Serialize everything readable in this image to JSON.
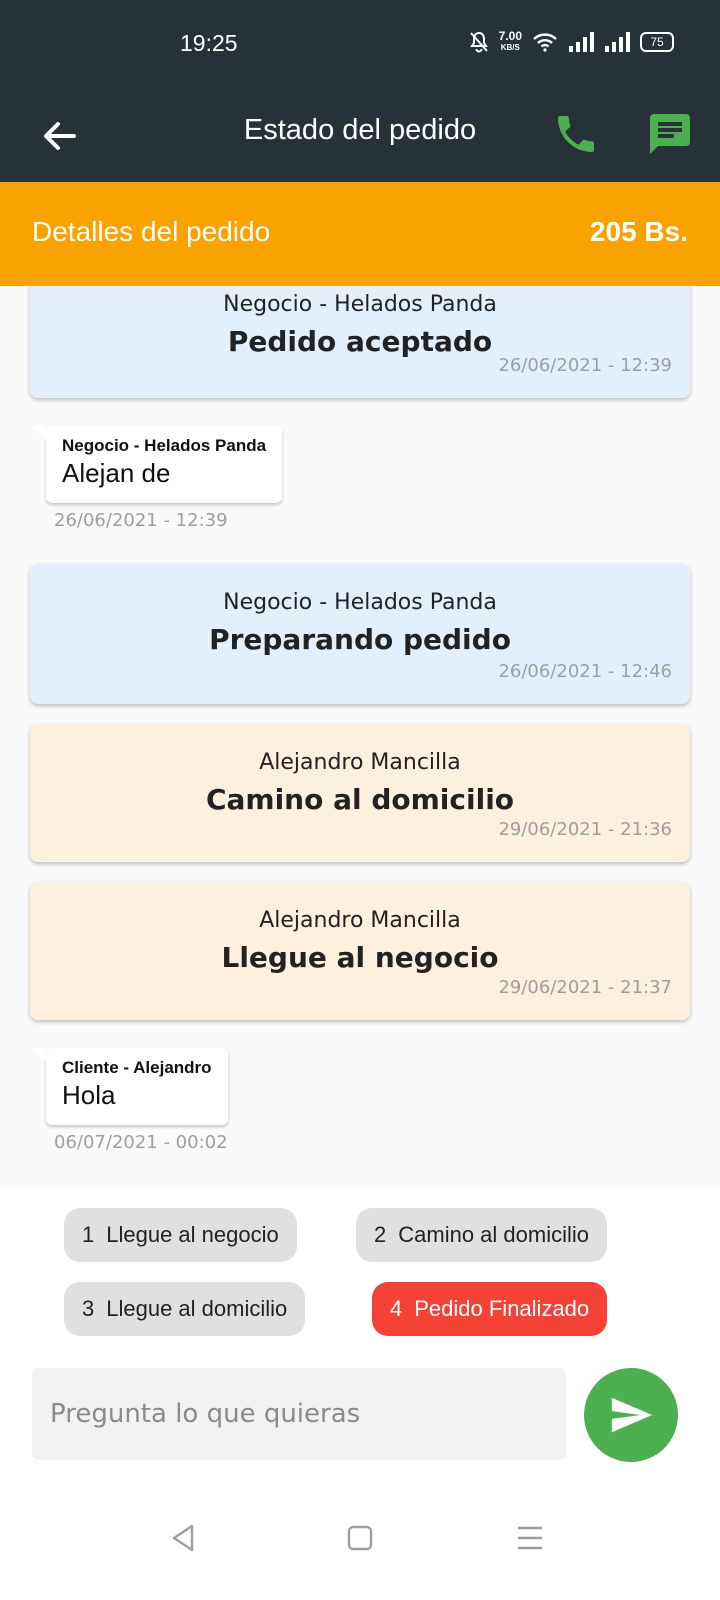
{
  "status_bar": {
    "time": "19:25",
    "net_speed": "7.00",
    "net_unit": "KB/S",
    "battery": "75",
    "icons": [
      "bell-muted-icon",
      "wifi-icon",
      "signal-icon",
      "signal-icon",
      "battery-icon"
    ]
  },
  "app_bar": {
    "title": "Estado del pedido",
    "icons": [
      "arrow-back-icon",
      "phone-icon",
      "message-icon"
    ],
    "accent_icon_color": "#4caf50",
    "background": "#263238"
  },
  "details": {
    "label": "Detalles del pedido",
    "total": "205 Bs.",
    "background": "#f9a200"
  },
  "feed": {
    "items": [
      {
        "kind": "status",
        "who": "Negocio - Helados Panda",
        "state": "Pedido aceptado",
        "time": "26/06/2021 - 12:39"
      },
      {
        "kind": "message",
        "sender": "Negocio - Helados Panda",
        "text": "Alejan de",
        "time": "26/06/2021 - 12:39"
      },
      {
        "kind": "status",
        "who": "Negocio - Helados Panda",
        "state": "Preparando pedido",
        "time": "26/06/2021 - 12:46"
      },
      {
        "kind": "status",
        "who": "Alejandro Mancilla",
        "state": "Camino al domicilio",
        "time": "29/06/2021 - 21:36"
      },
      {
        "kind": "status",
        "who": "Alejandro Mancilla",
        "state": "Llegue al negocio",
        "time": "29/06/2021 - 21:37"
      },
      {
        "kind": "message",
        "sender": "Cliente - Alejandro",
        "text": "Hola",
        "time": "06/07/2021 - 00:02"
      }
    ]
  },
  "actions": {
    "chips": [
      {
        "num": "1",
        "label": "Llegue al negocio"
      },
      {
        "num": "2",
        "label": "Camino al domicilio"
      },
      {
        "num": "3",
        "label": "Llegue al domicilio"
      },
      {
        "num": "4",
        "label": "Pedido Finalizado"
      }
    ],
    "active_chip_color": "#f44336"
  },
  "composer": {
    "placeholder": "Pregunta lo que quieras",
    "value": "",
    "send_icon": "send-icon",
    "send_color": "#4caf50"
  },
  "nav": {
    "icons": [
      "back-triangle-icon",
      "home-square-icon",
      "menu-lines-icon"
    ]
  }
}
